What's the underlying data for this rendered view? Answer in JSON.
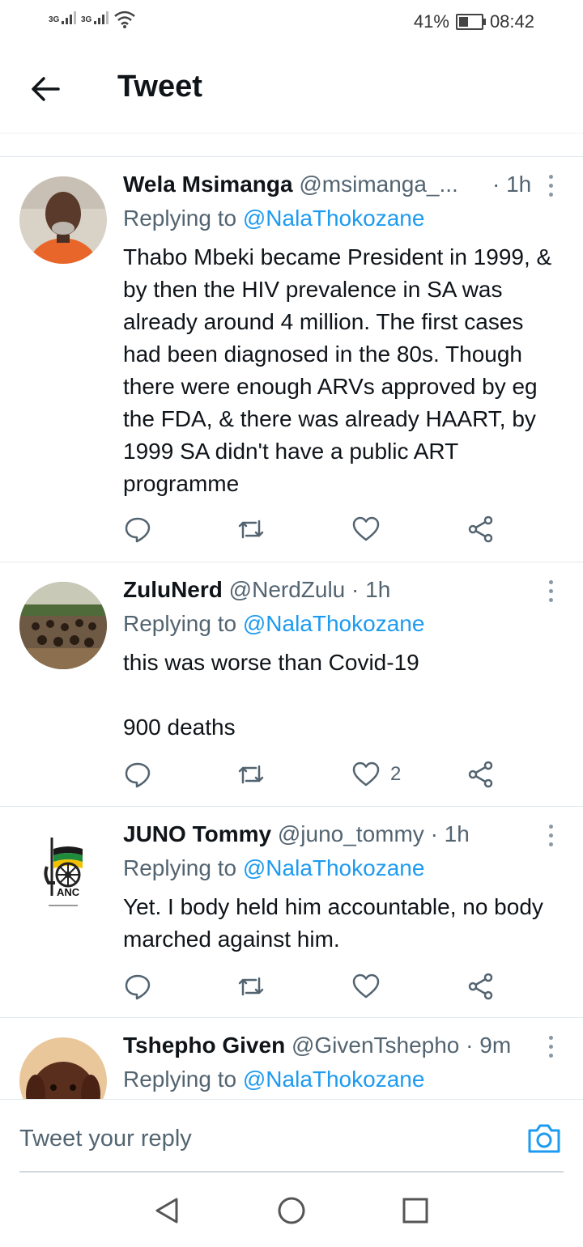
{
  "status_bar": {
    "signal1": "3G",
    "signal2": "3G",
    "battery": "41%",
    "battery_level": 0.41,
    "time": "08:42"
  },
  "header": {
    "title": "Tweet",
    "back_icon": "arrow-left-icon"
  },
  "tweets": [
    {
      "name": "Wela Msimanga",
      "handle": "@msimanga_...",
      "time": "· 1h",
      "replying_prefix": "Replying to ",
      "replying_to": "@NalaThokozane",
      "text": "Thabo Mbeki became President in 1999, & by then the HIV prevalence in SA was already around 4 million. The first cases had been diagnosed in the 80s. Though there were enough ARVs approved by eg the FDA, & there was already HAART, by 1999 SA didn't have a public ART programme",
      "likes": ""
    },
    {
      "name": "ZuluNerd",
      "handle": "@NerdZulu",
      "time": "· 1h",
      "replying_prefix": "Replying to ",
      "replying_to": "@NalaThokozane",
      "text": "this was worse than Covid-19\n\n900 deaths",
      "likes": "2"
    },
    {
      "name": "JUNO Tommy",
      "handle": "@juno_tommy",
      "time": "· 1h",
      "replying_prefix": "Replying to ",
      "replying_to": "@NalaThokozane",
      "text": "Yet. I body held him accountable, no body marched against him.",
      "likes": ""
    },
    {
      "name": "Tshepho Given",
      "handle": "@GivenTshepho",
      "time": "· 9m",
      "replying_prefix": "Replying to ",
      "replying_to": "@NalaThokozane"
    }
  ],
  "avatar_logo": {
    "text": "ANC"
  },
  "reply_bar": {
    "placeholder": "Tweet your reply",
    "camera_icon": "camera-icon"
  },
  "nav": {
    "back": "triangle-back-icon",
    "home": "circle-home-icon",
    "recents": "square-recents-icon"
  },
  "colors": {
    "accent": "#1d9bf0",
    "text": "#0f1419",
    "muted": "#536471"
  }
}
